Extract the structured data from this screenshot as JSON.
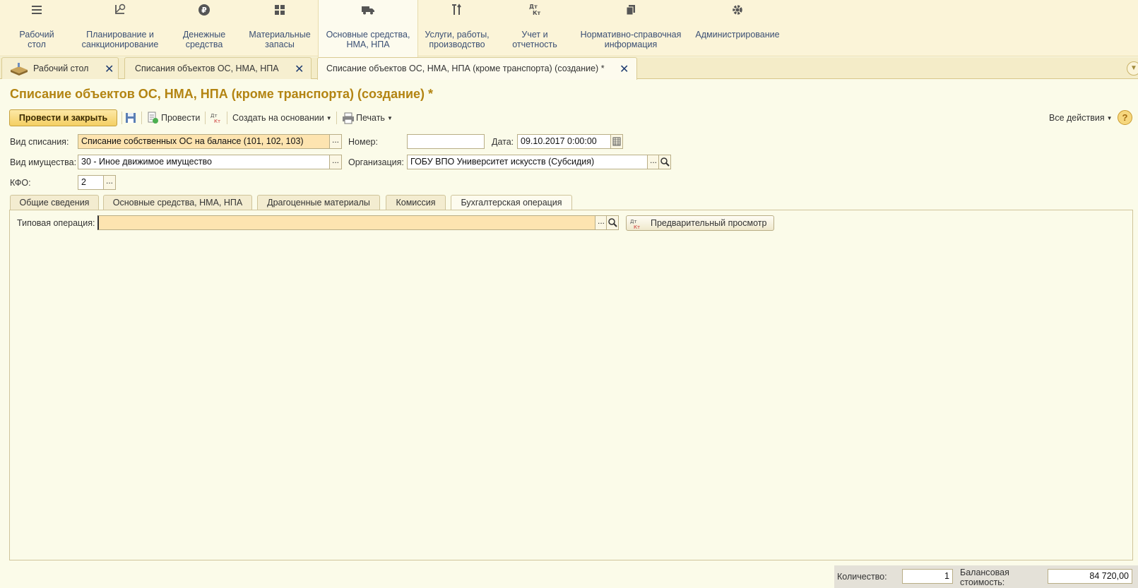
{
  "sections": [
    {
      "label1": "Рабочий",
      "label2": "стол",
      "icon": "list-icon"
    },
    {
      "label1": "Планирование и",
      "label2": "санкционирование",
      "icon": "planning-icon"
    },
    {
      "label1": "Денежные",
      "label2": "средства",
      "icon": "ruble-icon"
    },
    {
      "label1": "Материальные",
      "label2": "запасы",
      "icon": "grid-icon"
    },
    {
      "label1": "Основные средства,",
      "label2": "НМА, НПА",
      "icon": "truck-icon"
    },
    {
      "label1": "Услуги, работы,",
      "label2": "производство",
      "icon": "tools-icon"
    },
    {
      "label1": "Учет и",
      "label2": "отчетность",
      "icon": "debit-credit-icon"
    },
    {
      "label1": "Нормативно-справочная",
      "label2": "информация",
      "icon": "documents-icon"
    },
    {
      "label1": "Администрирование",
      "label2": "",
      "icon": "gear-icon"
    }
  ],
  "open_tabs": [
    {
      "label": "Рабочий стол"
    },
    {
      "label": "Списания объектов ОС, НМА, НПА"
    },
    {
      "label": "Списание объектов ОС, НМА, НПА (кроме транспорта) (создание) *"
    }
  ],
  "page_title": "Списание объектов ОС, НМА, НПА (кроме транспорта) (создание) *",
  "toolbar": {
    "post_close": "Провести и закрыть",
    "post": "Провести",
    "create_based": "Создать на основании",
    "print": "Печать",
    "all_actions": "Все действия",
    "help": "?"
  },
  "form": {
    "writeoff_type_label": "Вид списания:",
    "writeoff_type_value": "Списание собственных ОС на балансе (101, 102, 103)",
    "number_label": "Номер:",
    "number_value": "",
    "date_label": "Дата:",
    "date_value": "09.10.2017  0:00:00",
    "property_type_label": "Вид имущества:",
    "property_type_value": "30 - Иное движимое имущество",
    "org_label": "Организация:",
    "org_value": "ГОБУ ВПО Университет искусств (Субсидия)",
    "kfo_label": "КФО:",
    "kfo_value": "2",
    "dots": "..."
  },
  "inner_tabs": [
    {
      "label": "Общие сведения"
    },
    {
      "label": "Основные средства, НМА, НПА"
    },
    {
      "label": "Драгоценные материалы"
    },
    {
      "label": "Комиссия"
    },
    {
      "label": "Бухгалтерская операция"
    }
  ],
  "operation": {
    "label": "Типовая операция:",
    "value": "",
    "preview": "Предварительный просмотр"
  },
  "footer": {
    "qty_label": "Количество:",
    "qty_value": "1",
    "balance_label1": "Балансовая",
    "balance_label2": "стоимость:",
    "balance_value": "84 720,00"
  },
  "colors": {
    "accent": "#b38412",
    "link": "#3a4f74",
    "required_bg": "#fde4b0"
  }
}
